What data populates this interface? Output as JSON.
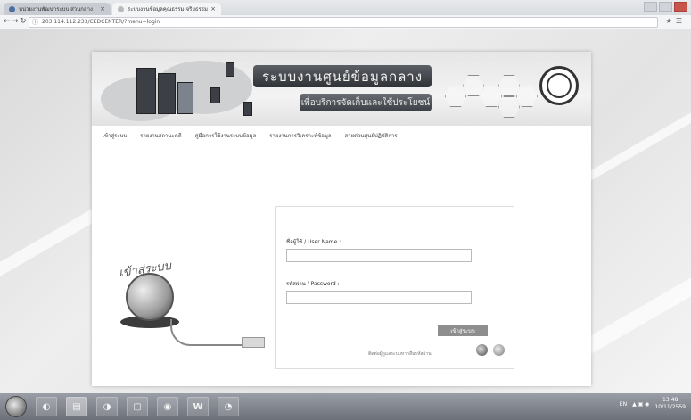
{
  "browser": {
    "tabs": [
      {
        "title": "หน่วยงานพัฒนาระบบ ส่วนกลาง",
        "active": false
      },
      {
        "title": "ระบบงานข้อมูลคุณธรรม-จริยธรรม",
        "active": true
      }
    ],
    "close_glyph": "×",
    "url": "203.114.112.233/CEDCENTER/?menu=login"
  },
  "site": {
    "title": "ระบบงานศูนย์ข้อมูลกลาง",
    "subtitle": "เพื่อบริการจัดเก็บและใช้ประโยชน์",
    "nav": [
      "เข้าสู่ระบบ",
      "รายงานสถานะคดี",
      "คู่มือการใช้งานระบบข้อมูล",
      "รายงานการวิเคราะห์ข้อมูล",
      "สายด่วนศูนย์ปฏิบัติการ"
    ],
    "enter_caption": "เข้าสู่ระบบ"
  },
  "login": {
    "username_label": "ชื่อผู้ใช้ / User Name :",
    "username_value": "",
    "password_label": "รหัสผ่าน / Password :",
    "password_value": "",
    "submit_label": "เข้าสู่ระบบ",
    "forgot_text": "ติดต่อผู้ดูแลระบบหากลืมรหัสผ่าน"
  },
  "taskbar": {
    "items": [
      {
        "name": "chrome",
        "glyph": "◐"
      },
      {
        "name": "explorer",
        "glyph": "▤"
      },
      {
        "name": "app",
        "glyph": "◑"
      },
      {
        "name": "window",
        "glyph": "▢"
      },
      {
        "name": "browser",
        "glyph": "◉"
      },
      {
        "name": "word",
        "glyph": "W"
      },
      {
        "name": "viewer",
        "glyph": "◔"
      }
    ],
    "language": "EN",
    "time": "13:48",
    "date": "10/11/2559"
  },
  "colors": {
    "accent": "#8e8e8e",
    "title_bar": "#3a3d42"
  }
}
